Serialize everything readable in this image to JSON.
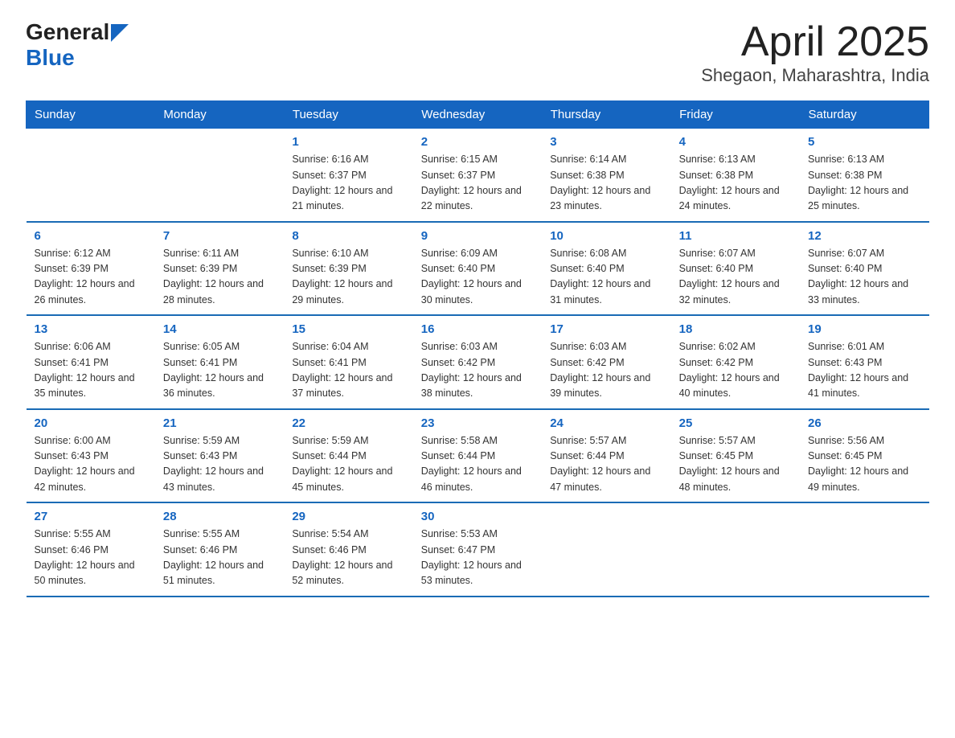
{
  "logo": {
    "general": "General",
    "blue": "Blue"
  },
  "title": "April 2025",
  "subtitle": "Shegaon, Maharashtra, India",
  "days_of_week": [
    "Sunday",
    "Monday",
    "Tuesday",
    "Wednesday",
    "Thursday",
    "Friday",
    "Saturday"
  ],
  "weeks": [
    [
      {
        "day": "",
        "sunrise": "",
        "sunset": "",
        "daylight": ""
      },
      {
        "day": "",
        "sunrise": "",
        "sunset": "",
        "daylight": ""
      },
      {
        "day": "1",
        "sunrise": "Sunrise: 6:16 AM",
        "sunset": "Sunset: 6:37 PM",
        "daylight": "Daylight: 12 hours and 21 minutes."
      },
      {
        "day": "2",
        "sunrise": "Sunrise: 6:15 AM",
        "sunset": "Sunset: 6:37 PM",
        "daylight": "Daylight: 12 hours and 22 minutes."
      },
      {
        "day": "3",
        "sunrise": "Sunrise: 6:14 AM",
        "sunset": "Sunset: 6:38 PM",
        "daylight": "Daylight: 12 hours and 23 minutes."
      },
      {
        "day": "4",
        "sunrise": "Sunrise: 6:13 AM",
        "sunset": "Sunset: 6:38 PM",
        "daylight": "Daylight: 12 hours and 24 minutes."
      },
      {
        "day": "5",
        "sunrise": "Sunrise: 6:13 AM",
        "sunset": "Sunset: 6:38 PM",
        "daylight": "Daylight: 12 hours and 25 minutes."
      }
    ],
    [
      {
        "day": "6",
        "sunrise": "Sunrise: 6:12 AM",
        "sunset": "Sunset: 6:39 PM",
        "daylight": "Daylight: 12 hours and 26 minutes."
      },
      {
        "day": "7",
        "sunrise": "Sunrise: 6:11 AM",
        "sunset": "Sunset: 6:39 PM",
        "daylight": "Daylight: 12 hours and 28 minutes."
      },
      {
        "day": "8",
        "sunrise": "Sunrise: 6:10 AM",
        "sunset": "Sunset: 6:39 PM",
        "daylight": "Daylight: 12 hours and 29 minutes."
      },
      {
        "day": "9",
        "sunrise": "Sunrise: 6:09 AM",
        "sunset": "Sunset: 6:40 PM",
        "daylight": "Daylight: 12 hours and 30 minutes."
      },
      {
        "day": "10",
        "sunrise": "Sunrise: 6:08 AM",
        "sunset": "Sunset: 6:40 PM",
        "daylight": "Daylight: 12 hours and 31 minutes."
      },
      {
        "day": "11",
        "sunrise": "Sunrise: 6:07 AM",
        "sunset": "Sunset: 6:40 PM",
        "daylight": "Daylight: 12 hours and 32 minutes."
      },
      {
        "day": "12",
        "sunrise": "Sunrise: 6:07 AM",
        "sunset": "Sunset: 6:40 PM",
        "daylight": "Daylight: 12 hours and 33 minutes."
      }
    ],
    [
      {
        "day": "13",
        "sunrise": "Sunrise: 6:06 AM",
        "sunset": "Sunset: 6:41 PM",
        "daylight": "Daylight: 12 hours and 35 minutes."
      },
      {
        "day": "14",
        "sunrise": "Sunrise: 6:05 AM",
        "sunset": "Sunset: 6:41 PM",
        "daylight": "Daylight: 12 hours and 36 minutes."
      },
      {
        "day": "15",
        "sunrise": "Sunrise: 6:04 AM",
        "sunset": "Sunset: 6:41 PM",
        "daylight": "Daylight: 12 hours and 37 minutes."
      },
      {
        "day": "16",
        "sunrise": "Sunrise: 6:03 AM",
        "sunset": "Sunset: 6:42 PM",
        "daylight": "Daylight: 12 hours and 38 minutes."
      },
      {
        "day": "17",
        "sunrise": "Sunrise: 6:03 AM",
        "sunset": "Sunset: 6:42 PM",
        "daylight": "Daylight: 12 hours and 39 minutes."
      },
      {
        "day": "18",
        "sunrise": "Sunrise: 6:02 AM",
        "sunset": "Sunset: 6:42 PM",
        "daylight": "Daylight: 12 hours and 40 minutes."
      },
      {
        "day": "19",
        "sunrise": "Sunrise: 6:01 AM",
        "sunset": "Sunset: 6:43 PM",
        "daylight": "Daylight: 12 hours and 41 minutes."
      }
    ],
    [
      {
        "day": "20",
        "sunrise": "Sunrise: 6:00 AM",
        "sunset": "Sunset: 6:43 PM",
        "daylight": "Daylight: 12 hours and 42 minutes."
      },
      {
        "day": "21",
        "sunrise": "Sunrise: 5:59 AM",
        "sunset": "Sunset: 6:43 PM",
        "daylight": "Daylight: 12 hours and 43 minutes."
      },
      {
        "day": "22",
        "sunrise": "Sunrise: 5:59 AM",
        "sunset": "Sunset: 6:44 PM",
        "daylight": "Daylight: 12 hours and 45 minutes."
      },
      {
        "day": "23",
        "sunrise": "Sunrise: 5:58 AM",
        "sunset": "Sunset: 6:44 PM",
        "daylight": "Daylight: 12 hours and 46 minutes."
      },
      {
        "day": "24",
        "sunrise": "Sunrise: 5:57 AM",
        "sunset": "Sunset: 6:44 PM",
        "daylight": "Daylight: 12 hours and 47 minutes."
      },
      {
        "day": "25",
        "sunrise": "Sunrise: 5:57 AM",
        "sunset": "Sunset: 6:45 PM",
        "daylight": "Daylight: 12 hours and 48 minutes."
      },
      {
        "day": "26",
        "sunrise": "Sunrise: 5:56 AM",
        "sunset": "Sunset: 6:45 PM",
        "daylight": "Daylight: 12 hours and 49 minutes."
      }
    ],
    [
      {
        "day": "27",
        "sunrise": "Sunrise: 5:55 AM",
        "sunset": "Sunset: 6:46 PM",
        "daylight": "Daylight: 12 hours and 50 minutes."
      },
      {
        "day": "28",
        "sunrise": "Sunrise: 5:55 AM",
        "sunset": "Sunset: 6:46 PM",
        "daylight": "Daylight: 12 hours and 51 minutes."
      },
      {
        "day": "29",
        "sunrise": "Sunrise: 5:54 AM",
        "sunset": "Sunset: 6:46 PM",
        "daylight": "Daylight: 12 hours and 52 minutes."
      },
      {
        "day": "30",
        "sunrise": "Sunrise: 5:53 AM",
        "sunset": "Sunset: 6:47 PM",
        "daylight": "Daylight: 12 hours and 53 minutes."
      },
      {
        "day": "",
        "sunrise": "",
        "sunset": "",
        "daylight": ""
      },
      {
        "day": "",
        "sunrise": "",
        "sunset": "",
        "daylight": ""
      },
      {
        "day": "",
        "sunrise": "",
        "sunset": "",
        "daylight": ""
      }
    ]
  ]
}
